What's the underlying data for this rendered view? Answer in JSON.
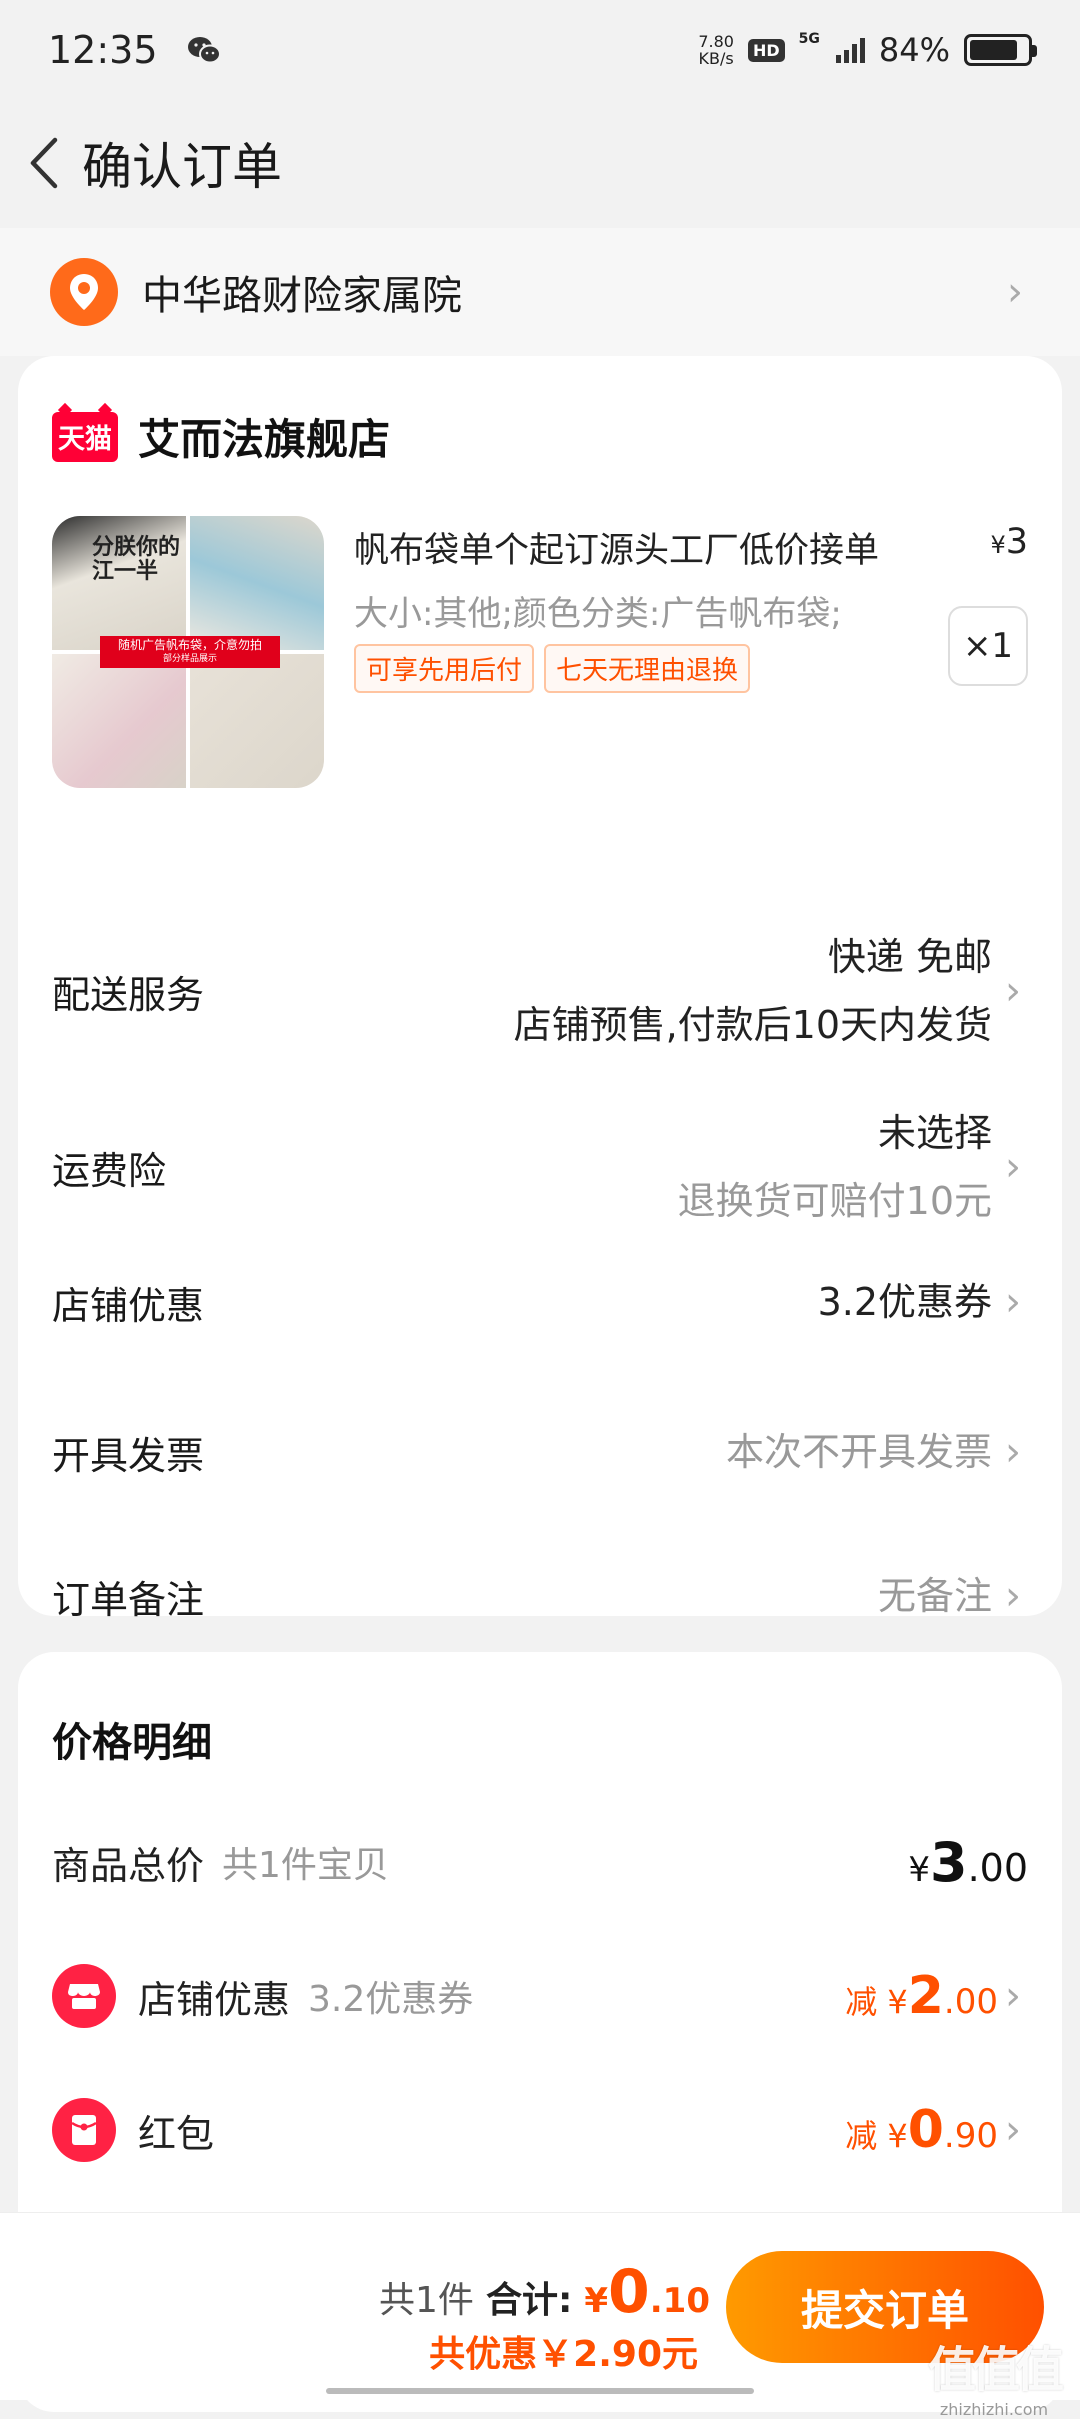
{
  "status_bar": {
    "time": "12:35",
    "net_speed_value": "7.80",
    "net_speed_unit": "KB/s",
    "hd": "HD",
    "network": "5G",
    "battery_percent": "84%",
    "battery_level": 0.84
  },
  "nav": {
    "title": "确认订单"
  },
  "address": {
    "text": "中华路财险家属院"
  },
  "shop": {
    "logo_text": "天猫",
    "name": "艾而法旗舰店"
  },
  "product": {
    "image_banner": "随机广告帆布袋，介意勿拍",
    "image_banner_sub": "部分样品展示",
    "image_calligraphy": "分朕你的江一半",
    "title": "帆布袋单个起订源头工厂低价接单",
    "price_symbol": "¥",
    "price": "3",
    "spec": "大小:其他;颜色分类:广告帆布袋;",
    "tags": [
      "可享先用后付",
      "七天无理由退换"
    ],
    "quantity": "×1"
  },
  "order_rows": {
    "delivery": {
      "label": "配送服务",
      "value": "快递 免邮",
      "sub": "店铺预售,付款后10天内发货"
    },
    "insurance": {
      "label": "运费险",
      "value": "未选择",
      "sub": "退换货可赔付10元"
    },
    "shop_discount": {
      "label": "店铺优惠",
      "value": "3.2优惠券"
    },
    "invoice": {
      "label": "开具发票",
      "value": "本次不开具发票"
    },
    "remark": {
      "label": "订单备注",
      "value": "无备注"
    }
  },
  "price_detail": {
    "title": "价格明细",
    "goods_total": {
      "label": "商品总价",
      "sub": "共1件宝贝",
      "yen": "¥",
      "int": "3",
      "dec": ".00"
    },
    "shop_discount": {
      "label": "店铺优惠",
      "sub": "3.2优惠券",
      "prefix": "减",
      "yen": "¥",
      "int": "2",
      "dec": ".00"
    },
    "red_packet": {
      "label": "红包",
      "prefix": "减",
      "yen": "¥",
      "int": "0",
      "dec": ".90"
    }
  },
  "bottom_bar": {
    "count": "共1件",
    "total_label": "合计:",
    "total_yen": "¥",
    "total_int": "0",
    "total_dec": ".10",
    "saved": "共优惠￥2.90元",
    "submit": "提交订单"
  },
  "watermark": {
    "logo": "值值值",
    "url": "zhizhizhi.com"
  },
  "colors": {
    "accent": "#ff5000",
    "tmall_red": "#ff0036",
    "location_orange": "#ff6a1a"
  }
}
